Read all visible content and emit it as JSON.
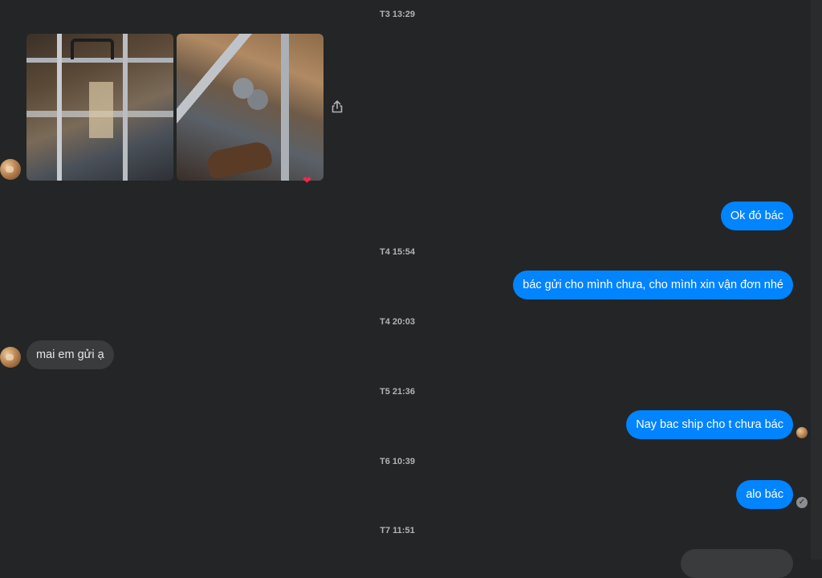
{
  "conversation": {
    "timestamps": [
      "T3 13:29",
      "T4 15:54",
      "T4 20:03",
      "T5 21:36",
      "T6 10:39",
      "T7 11:51"
    ],
    "messages": {
      "m1": "Ok đó bác",
      "m2": "bác gửi cho mình chưa, cho mình xin vận đơn nhé",
      "m3": "mai em gửi ạ",
      "m4": "Nay bac ship cho t chưa bác",
      "m5": "alo bác"
    },
    "reaction": "❤",
    "seen_mark": "✓",
    "icons": [
      "share-icon",
      "heart-reaction-icon",
      "seen-check-icon",
      "avatar"
    ]
  },
  "colors": {
    "background": "#242526",
    "outgoing_bubble": "#0084ff",
    "incoming_bubble": "#3a3b3c",
    "timestamp_text": "#b0b3b8"
  }
}
